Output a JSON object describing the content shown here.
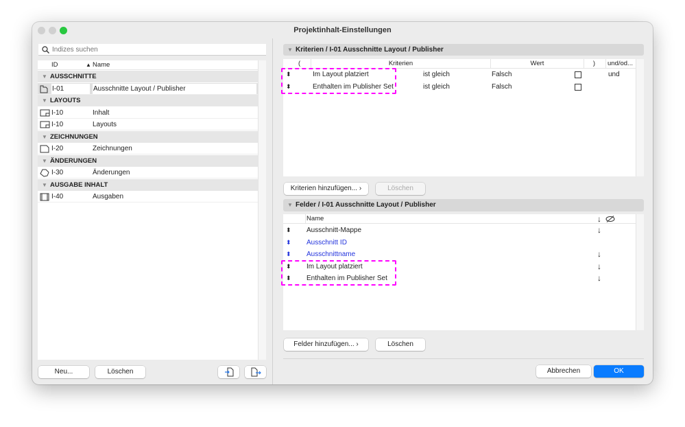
{
  "window": {
    "title": "Projektinhalt-Einstellungen"
  },
  "left": {
    "search_placeholder": "Indizes suchen",
    "col_id": "ID",
    "col_name": "Name",
    "sort_indicator": "▲",
    "rows": [
      {
        "type": "group",
        "label": "AUSSCHNITTE"
      },
      {
        "type": "item",
        "icon": "view-icon",
        "id": "I-01",
        "name": "Ausschnitte Layout / Publisher",
        "selected": true
      },
      {
        "type": "group",
        "label": "LAYOUTS"
      },
      {
        "type": "item",
        "icon": "layout-icon",
        "id": "I-10",
        "name": "Inhalt"
      },
      {
        "type": "item",
        "icon": "layout-icon",
        "id": "I-10",
        "name": "Layouts"
      },
      {
        "type": "group",
        "label": "ZEICHNUNGEN"
      },
      {
        "type": "item",
        "icon": "drawing-icon",
        "id": "I-20",
        "name": "Zeichnungen"
      },
      {
        "type": "group",
        "label": "ÄNDERUNGEN"
      },
      {
        "type": "item",
        "icon": "revision-cloud-icon",
        "id": "I-30",
        "name": "Änderungen"
      },
      {
        "type": "group",
        "label": "AUSGABE INHALT"
      },
      {
        "type": "item",
        "icon": "publisher-icon",
        "id": "I-40",
        "name": "Ausgaben"
      }
    ],
    "new_button": "Neu...",
    "delete_button": "Löschen"
  },
  "criteria": {
    "header": "Kriterien / I-01 Ausschnitte Layout / Publisher",
    "columns": {
      "open": "(",
      "criteria": "Kriterien",
      "value": "Wert",
      "close": ")",
      "andor": "und/od..."
    },
    "rows": [
      {
        "name": "Im Layout platziert",
        "operator": "ist gleich",
        "value": "Falsch",
        "checked": false,
        "andor": "und"
      },
      {
        "name": "Enthalten im Publisher Set",
        "operator": "ist gleich",
        "value": "Falsch",
        "checked": false,
        "andor": ""
      }
    ],
    "add_button": "Kriterien hinzufügen...",
    "delete_button": "Löschen"
  },
  "fields": {
    "header": "Felder / I-01 Ausschnitte Layout / Publisher",
    "col_name": "Name",
    "col_sort": "↓",
    "rows": [
      {
        "name": "Ausschnitt-Mappe",
        "blue": false,
        "sort": "↓"
      },
      {
        "name": "Ausschnitt ID",
        "blue": true,
        "sort": ""
      },
      {
        "name": "Ausschnittname",
        "blue": true,
        "sort": "↓"
      },
      {
        "name": "Im Layout platziert",
        "blue": false,
        "sort": "↓"
      },
      {
        "name": "Enthalten im Publisher Set",
        "blue": false,
        "sort": "↓"
      }
    ],
    "add_button": "Felder hinzufügen...",
    "delete_button": "Löschen"
  },
  "footer": {
    "cancel": "Abbrechen",
    "ok": "OK"
  },
  "colors": {
    "accent": "#0a7cff",
    "highlight": "#ff00ff",
    "link": "#2233dd"
  }
}
